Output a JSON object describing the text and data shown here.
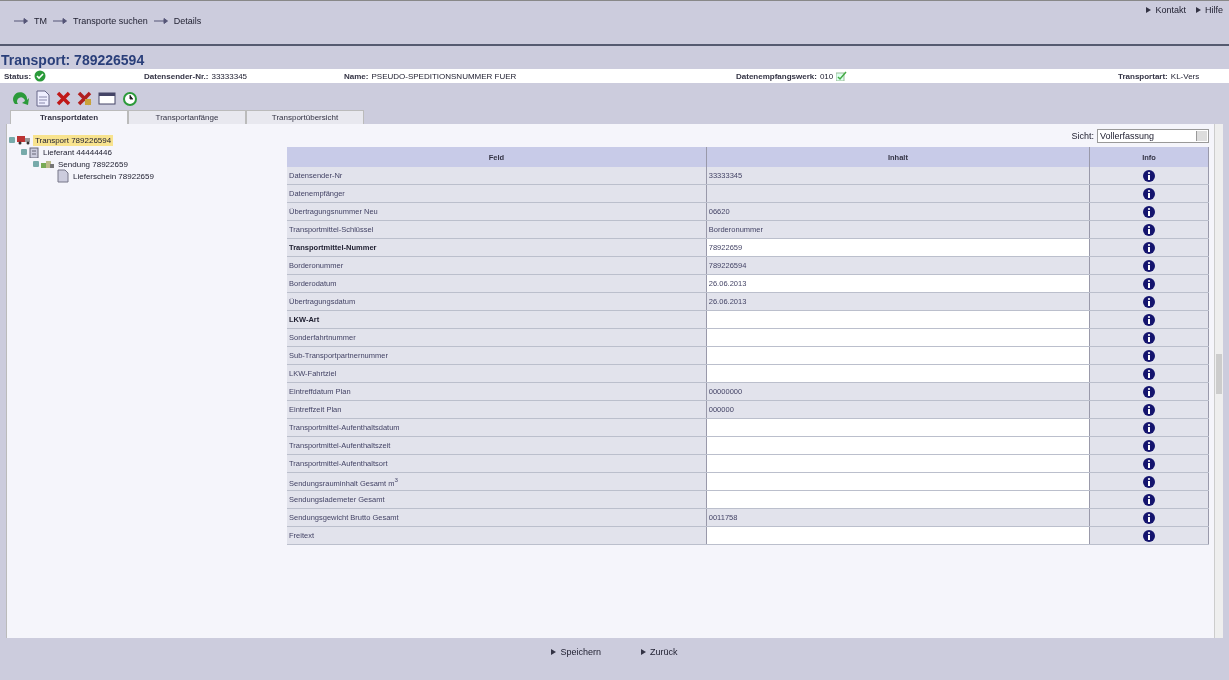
{
  "top_links": [
    "Kontakt",
    "Hilfe"
  ],
  "breadcrumb": [
    "TM",
    "Transporte suchen",
    "Details"
  ],
  "title": "Transport: 789226594",
  "info": [
    {
      "kind": "status",
      "label": "Status:"
    },
    {
      "kind": "text",
      "label": "Datensender-Nr.:",
      "value": "33333345"
    },
    {
      "kind": "text",
      "label": "Name:",
      "value": "PSEUDO-SPEDITIONSNUMMER FUER"
    },
    {
      "kind": "check",
      "label": "Datenempfangswerk:",
      "value": "010"
    },
    {
      "kind": "text",
      "label": "Transportart:",
      "value": "KL-Vers"
    }
  ],
  "toolbar": [
    {
      "kind": "refresh"
    },
    {
      "kind": "document"
    },
    {
      "kind": "delete"
    },
    {
      "kind": "delete-split"
    },
    {
      "kind": "window"
    },
    {
      "kind": "history"
    }
  ],
  "tabs": [
    {
      "label": "Transportdaten",
      "selected": true
    },
    {
      "label": "Transportanfänge",
      "selected": false
    },
    {
      "label": "Transportübersicht",
      "selected": false
    }
  ],
  "tree": [
    {
      "label": "Transport 789226594",
      "kind": "truck",
      "selected": true,
      "expanded": true,
      "children": [
        {
          "label": "Lieferant 44444446",
          "kind": "building",
          "selected": false,
          "expanded": true,
          "children": [
            {
              "label": "Sendung 78922659",
              "kind": "boxes",
              "selected": false,
              "expanded": true,
              "children": [
                {
                  "label": "Lieferschein 78922659",
                  "kind": "document",
                  "selected": false
                }
              ]
            }
          ]
        }
      ]
    }
  ],
  "view": {
    "label": "Sicht:",
    "value": "Vollerfassung"
  },
  "table": {
    "columns": [
      "Feld",
      "Inhalt",
      "Info"
    ],
    "rows": [
      {
        "field": "Datensender-Nr",
        "value": "33333345",
        "bold": false,
        "editable": false
      },
      {
        "field": "Datenempfänger",
        "bold": false,
        "editable": false
      },
      {
        "field": "Übertragungsnummer Neu",
        "value": "06620",
        "bold": false,
        "editable": false
      },
      {
        "field": "Transportmittel-Schlüssel",
        "value": "Borderonummer",
        "bold": false,
        "editable": false
      },
      {
        "field": "Transportmittel-Nummer",
        "value": "78922659",
        "bold": true,
        "editable": true
      },
      {
        "field": "Borderonummer",
        "value": "789226594",
        "bold": false,
        "editable": false
      },
      {
        "field": "Borderodatum",
        "value": "26.06.2013",
        "bold": false,
        "editable": true
      },
      {
        "field": "Übertragungsdatum",
        "value": "26.06.2013",
        "bold": false,
        "editable": false
      },
      {
        "field": "LKW-Art",
        "bold": true,
        "editable": true
      },
      {
        "field": "Sonderfahrtnummer",
        "bold": false,
        "editable": true
      },
      {
        "field": "Sub-Transportpartnernummer",
        "bold": false,
        "editable": true
      },
      {
        "field": "LKW-Fahrtziel",
        "bold": false,
        "editable": true
      },
      {
        "field": "Eintreffdatum Plan",
        "value": "00000000",
        "bold": false,
        "editable": false
      },
      {
        "field": "Eintreffzeit Plan",
        "value": "000000",
        "bold": false,
        "editable": false
      },
      {
        "field": "Transportmittel-Aufenthaltsdatum",
        "bold": false,
        "editable": true
      },
      {
        "field": "Transportmittel-Aufenthaltszeit",
        "bold": false,
        "editable": true
      },
      {
        "field": "Transportmittel-Aufenthaltsort",
        "bold": false,
        "editable": true
      },
      {
        "field": "Sendungsrauminhalt Gesamt m$^{3}$",
        "bold": false,
        "editable": true
      },
      {
        "field": "Sendungslademeter Gesamt",
        "bold": false,
        "editable": true
      },
      {
        "field": "Sendungsgewicht Brutto Gesamt",
        "value": "0011758",
        "bold": false,
        "editable": false
      },
      {
        "field": "Freitext",
        "bold": false,
        "editable": true
      }
    ]
  },
  "footer": [
    "Speichern",
    "Zurück"
  ]
}
